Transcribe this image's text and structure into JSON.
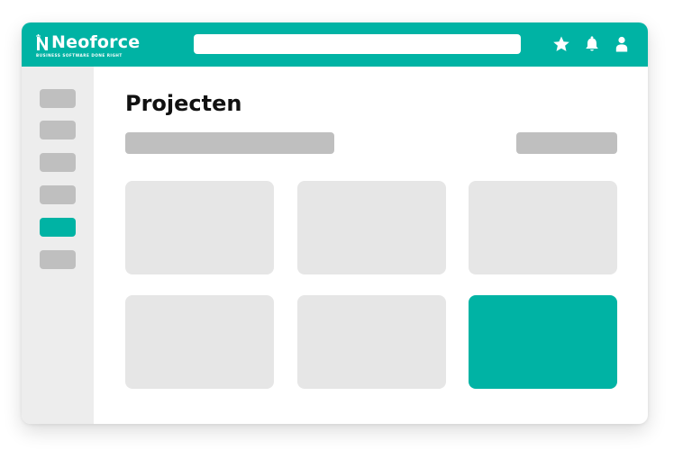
{
  "app": {
    "brand_name": "Neoforce",
    "tagline": "BUSINESS SOFTWARE DONE RIGHT"
  },
  "colors": {
    "accent": "#00b3a4",
    "placeholder": "#bfbfbf",
    "card": "#e6e6e6",
    "sidebar_bg": "#ededed",
    "text": "#111111"
  },
  "header": {
    "search_placeholder": "",
    "icons": [
      "star-icon",
      "bell-icon",
      "user-icon"
    ]
  },
  "sidebar": {
    "items": [
      {
        "active": false
      },
      {
        "active": false
      },
      {
        "active": false
      },
      {
        "active": false
      },
      {
        "active": true
      },
      {
        "active": false
      }
    ]
  },
  "main": {
    "title": "Projecten",
    "cards": [
      {
        "highlighted": false
      },
      {
        "highlighted": false
      },
      {
        "highlighted": false
      },
      {
        "highlighted": false
      },
      {
        "highlighted": false
      },
      {
        "highlighted": true
      }
    ]
  }
}
